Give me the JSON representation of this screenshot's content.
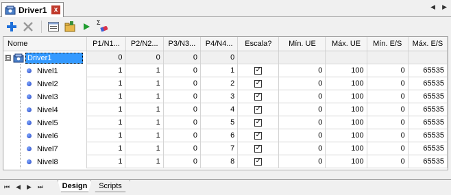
{
  "doc_tab": {
    "title": "Driver1",
    "close_symbol": "x"
  },
  "nav": {
    "prev": "◀",
    "next": "▶"
  },
  "toolbar": {
    "buttons": [
      "add-icon",
      "delete-icon",
      "properties-icon",
      "open-folder-icon",
      "run-icon",
      "sum-icon"
    ],
    "sum_symbol": "Σ"
  },
  "grid": {
    "columns": [
      "Nome",
      "P1/N1...",
      "P2/N2...",
      "P3/N3...",
      "P4/N4...",
      "Escala?",
      "Mín. UE",
      "Máx. UE",
      "Mín. E/S",
      "Máx. E/S"
    ],
    "root": {
      "expander": "⊟",
      "name": "Driver1",
      "p1": "0",
      "p2": "0",
      "p3": "0",
      "p4": "0"
    },
    "rows": [
      {
        "name": "Nivel1",
        "p1": "1",
        "p2": "1",
        "p3": "0",
        "p4": "1",
        "escala": true,
        "min_ue": "0",
        "max_ue": "100",
        "min_es": "0",
        "max_es": "65535"
      },
      {
        "name": "Nivel2",
        "p1": "1",
        "p2": "1",
        "p3": "0",
        "p4": "2",
        "escala": true,
        "min_ue": "0",
        "max_ue": "100",
        "min_es": "0",
        "max_es": "65535"
      },
      {
        "name": "Nivel3",
        "p1": "1",
        "p2": "1",
        "p3": "0",
        "p4": "3",
        "escala": true,
        "min_ue": "0",
        "max_ue": "100",
        "min_es": "0",
        "max_es": "65535"
      },
      {
        "name": "Nivel4",
        "p1": "1",
        "p2": "1",
        "p3": "0",
        "p4": "4",
        "escala": true,
        "min_ue": "0",
        "max_ue": "100",
        "min_es": "0",
        "max_es": "65535"
      },
      {
        "name": "Nivel5",
        "p1": "1",
        "p2": "1",
        "p3": "0",
        "p4": "5",
        "escala": true,
        "min_ue": "0",
        "max_ue": "100",
        "min_es": "0",
        "max_es": "65535"
      },
      {
        "name": "Nivel6",
        "p1": "1",
        "p2": "1",
        "p3": "0",
        "p4": "6",
        "escala": true,
        "min_ue": "0",
        "max_ue": "100",
        "min_es": "0",
        "max_es": "65535"
      },
      {
        "name": "Nivel7",
        "p1": "1",
        "p2": "1",
        "p3": "0",
        "p4": "7",
        "escala": true,
        "min_ue": "0",
        "max_ue": "100",
        "min_es": "0",
        "max_es": "65535"
      },
      {
        "name": "Nivel8",
        "p1": "1",
        "p2": "1",
        "p3": "0",
        "p4": "8",
        "escala": true,
        "min_ue": "0",
        "max_ue": "100",
        "min_es": "0",
        "max_es": "65535"
      }
    ],
    "check_mark": "✓"
  },
  "bottom_nav": {
    "first": "⏮",
    "prev": "◀",
    "next": "▶",
    "last": "⏭"
  },
  "bottom_tabs": {
    "design": "Design",
    "scripts": "Scripts"
  }
}
